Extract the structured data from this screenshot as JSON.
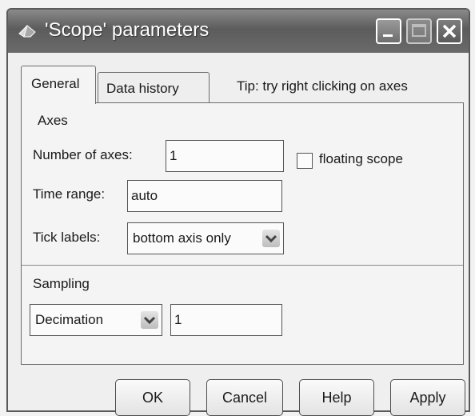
{
  "window": {
    "title": "'Scope' parameters"
  },
  "tabs": [
    {
      "label": "General",
      "selected": true
    },
    {
      "label": "Data history",
      "selected": false
    }
  ],
  "tip": "Tip: try right clicking on axes",
  "axes": {
    "section_label": "Axes",
    "number_of_axes_label": "Number of axes:",
    "number_of_axes_value": "1",
    "floating_scope_label": "floating scope",
    "floating_scope_checked": false,
    "time_range_label": "Time range:",
    "time_range_value": "auto",
    "tick_labels_label": "Tick labels:",
    "tick_labels_value": "bottom axis only"
  },
  "sampling": {
    "section_label": "Sampling",
    "mode_value": "Decimation",
    "factor_value": "1"
  },
  "buttons": {
    "ok": "OK",
    "cancel": "Cancel",
    "help": "Help",
    "apply": "Apply"
  },
  "icons": {
    "app": "simulink-block-icon",
    "minimize": "minimize-icon",
    "maximize": "maximize-icon",
    "close": "close-icon",
    "dropdown": "chevron-down-icon"
  }
}
